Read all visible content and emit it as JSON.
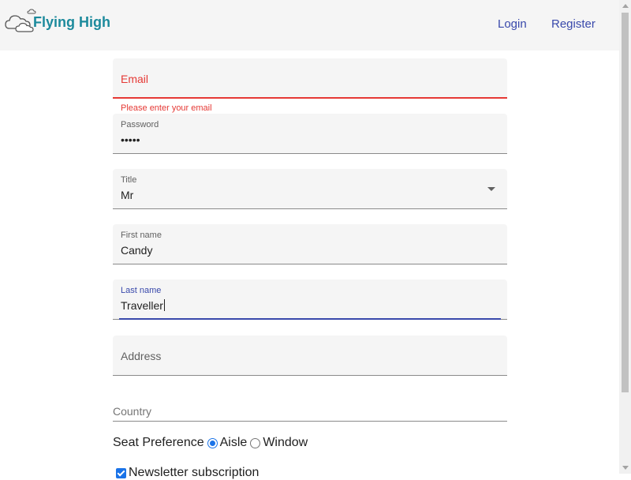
{
  "header": {
    "logo_text": "Flying High",
    "login_label": "Login",
    "register_label": "Register"
  },
  "form": {
    "email": {
      "placeholder": "Email",
      "error": "Please enter your email"
    },
    "password": {
      "label": "Password",
      "value": "•••••"
    },
    "title": {
      "label": "Title",
      "value": "Mr"
    },
    "first_name": {
      "label": "First name",
      "value": "Candy"
    },
    "last_name": {
      "label": "Last name",
      "value": "Traveller"
    },
    "address": {
      "placeholder": "Address"
    },
    "country": {
      "placeholder": "Country"
    },
    "seat_preference": {
      "label": "Seat Preference",
      "options": [
        {
          "label": "Aisle",
          "checked": true
        },
        {
          "label": "Window",
          "checked": false
        }
      ]
    },
    "newsletter": {
      "label": "Newsletter subscription",
      "checked": true
    }
  },
  "colors": {
    "accent": "#3949ab",
    "error": "#e53935",
    "logo": "#1c8a9c",
    "field_bg": "#f5f5f5"
  },
  "icons": [
    "cloud-logo-icon",
    "dropdown-arrow-icon"
  ]
}
